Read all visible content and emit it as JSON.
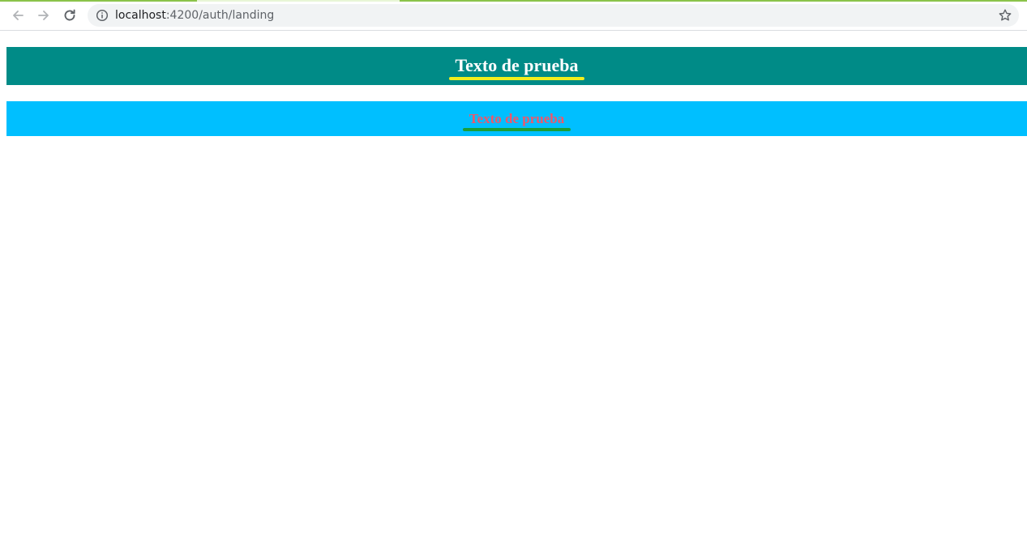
{
  "browser": {
    "url_host": "localhost",
    "url_rest": ":4200/auth/landing",
    "load_bar_color": "#8bc34a",
    "icons": {
      "back": "arrow-left-icon",
      "forward": "arrow-right-icon",
      "reload": "reload-icon",
      "site_info": "info-icon",
      "bookmark": "star-icon"
    }
  },
  "page": {
    "banner_1": {
      "text": "Texto de prueba",
      "background": "#008b87",
      "text_color": "#ffffff",
      "underline_color": "#f2ee1e"
    },
    "banner_2": {
      "text": "Texto de prueba",
      "background": "#00bfff",
      "text_color": "#f0566a",
      "underline_color": "#1a9e3a"
    }
  }
}
